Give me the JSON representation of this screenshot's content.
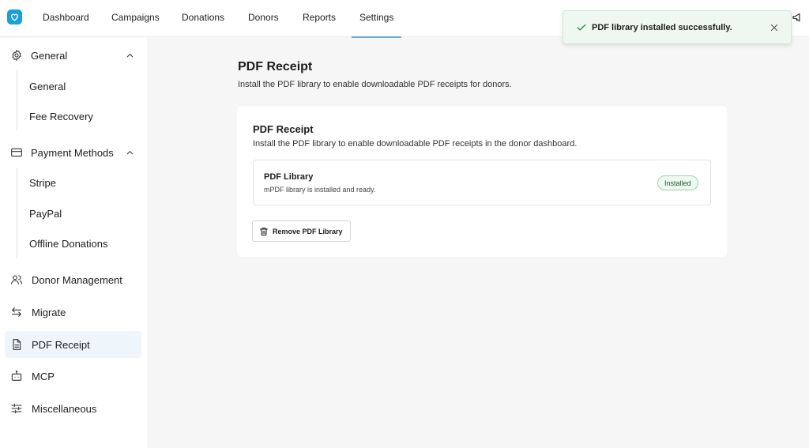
{
  "nav": {
    "items": [
      "Dashboard",
      "Campaigns",
      "Donations",
      "Donors",
      "Reports",
      "Settings"
    ],
    "active": "Settings"
  },
  "toast": {
    "message": "PDF library installed successfully.",
    "status_color": "#2e8b4e"
  },
  "sidebar": {
    "general": {
      "label": "General",
      "children": [
        "General",
        "Fee Recovery"
      ]
    },
    "payment_methods": {
      "label": "Payment Methods",
      "children": [
        "Stripe",
        "PayPal",
        "Offline Donations"
      ]
    },
    "items": [
      "Donor Management",
      "Migrate",
      "PDF Receipt",
      "MCP",
      "Miscellaneous"
    ],
    "active": "PDF Receipt"
  },
  "main": {
    "title": "PDF Receipt",
    "subtitle": "Install the PDF library to enable downloadable PDF receipts for donors.",
    "card": {
      "title": "PDF Receipt",
      "subtitle": "Install the PDF library to enable downloadable PDF receipts in the donor dashboard.",
      "library": {
        "title": "PDF Library",
        "description": "mPDF library is installed and ready.",
        "status": "Installed"
      },
      "remove_label": "Remove PDF Library"
    }
  },
  "colors": {
    "brand": "#1a9fd8",
    "active_bg": "#eef5fb",
    "success": "#2e8b4e"
  }
}
